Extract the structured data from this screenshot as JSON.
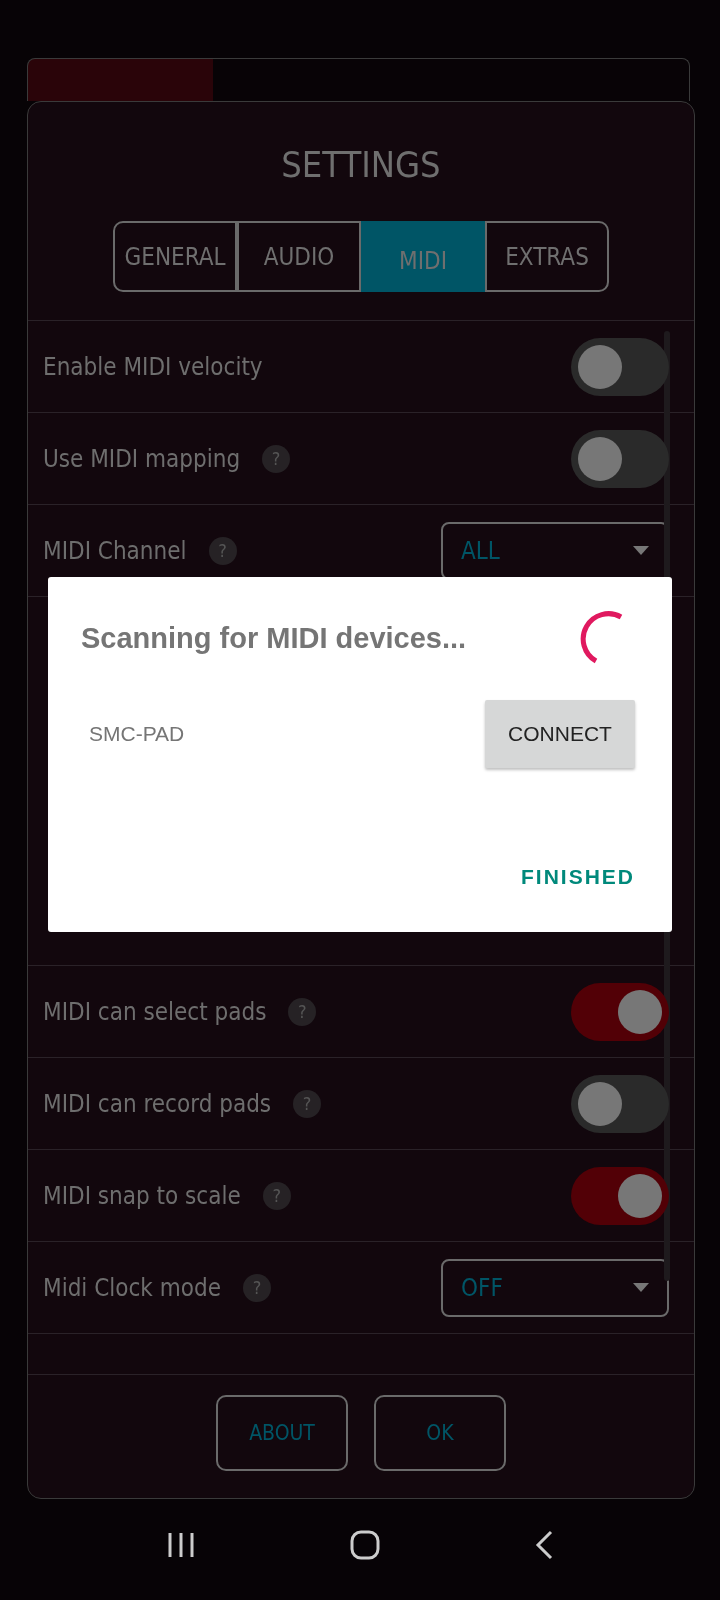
{
  "settings": {
    "title": "SETTINGS",
    "tabs": [
      {
        "label": "GENERAL",
        "selected": false
      },
      {
        "label": "AUDIO",
        "selected": false
      },
      {
        "label": "MIDI",
        "selected": true
      },
      {
        "label": "EXTRAS",
        "selected": false
      }
    ],
    "rows_top": [
      {
        "kind": "toggle",
        "label": "Enable MIDI velocity",
        "on": false
      },
      {
        "kind": "toggle",
        "label": "Use MIDI mapping",
        "help": "?",
        "on": false
      },
      {
        "kind": "dropdown",
        "label": "MIDI Channel",
        "help": "?",
        "value": "ALL"
      }
    ],
    "rows_bottom": [
      {
        "kind": "toggle",
        "label": "MIDI can select pads",
        "help": "?",
        "on": true
      },
      {
        "kind": "toggle",
        "label": "MIDI can record pads",
        "help": "?",
        "on": false
      },
      {
        "kind": "toggle",
        "label": "MIDI snap to scale",
        "help": "?",
        "on": true
      },
      {
        "kind": "dropdown",
        "label": "Midi Clock mode",
        "help": "?",
        "value": "OFF"
      }
    ],
    "buttons": [
      "ABOUT",
      "OK"
    ]
  },
  "dialog": {
    "title": "Scanning for MIDI devices...",
    "devices": [
      {
        "name": "SMC-PAD",
        "action": "CONNECT"
      }
    ],
    "finish": "FINISHED"
  }
}
